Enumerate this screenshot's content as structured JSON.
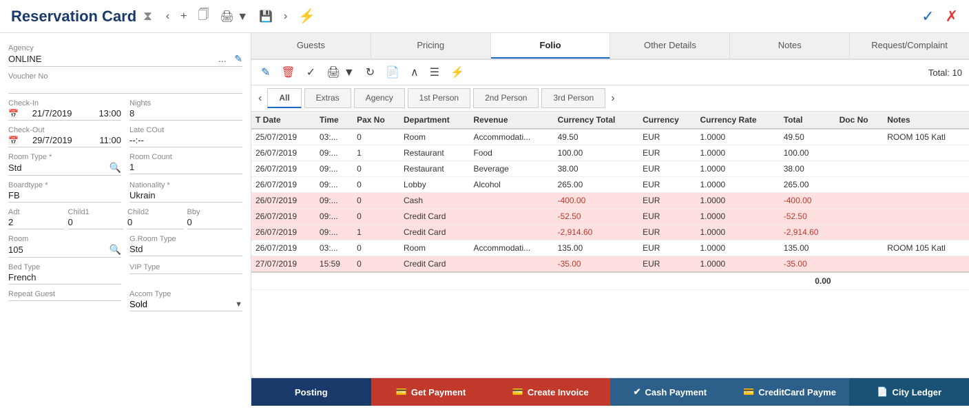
{
  "header": {
    "title": "Reservation Card",
    "check_label": "✓",
    "x_label": "✗"
  },
  "left": {
    "agency_label": "Agency",
    "agency_value": "ONLINE",
    "voucher_label": "Voucher No",
    "checkin_label": "Check-In",
    "checkin_date": "21/7/2019",
    "checkin_time": "13:00",
    "nights_label": "Nights",
    "nights_value": "8",
    "checkout_label": "Check-Out",
    "checkout_date": "29/7/2019",
    "checkout_time": "11:00",
    "late_cout_label": "Late COut",
    "late_cout_value": "--:--",
    "room_type_label": "Room Type *",
    "room_type_value": "Std",
    "room_count_label": "Room Count",
    "room_count_value": "1",
    "boardtype_label": "Boardtype *",
    "boardtype_value": "FB",
    "nationality_label": "Nationality *",
    "nationality_value": "Ukrain",
    "adt_label": "Adt",
    "adt_value": "2",
    "child1_label": "Child1",
    "child1_value": "0",
    "child2_label": "Child2",
    "child2_value": "0",
    "bby_label": "Bby",
    "bby_value": "0",
    "room_label": "Room",
    "room_value": "105",
    "groom_type_label": "G.Room Type",
    "groom_type_value": "Std",
    "bed_type_label": "Bed Type",
    "bed_type_value": "French",
    "vip_type_label": "VIP Type",
    "vip_type_value": "",
    "repeat_guest_label": "Repeat Guest",
    "accom_type_label": "Accom Type",
    "accom_type_value": "Sold"
  },
  "tabs": [
    "Guests",
    "Pricing",
    "Folio",
    "Other Details",
    "Notes",
    "Request/Complaint"
  ],
  "active_tab": "Folio",
  "sub_tabs": [
    "All",
    "Extras",
    "Agency",
    "1st Person",
    "2nd Person",
    "3rd Person"
  ],
  "active_sub_tab": "All",
  "total_label": "Total: 10",
  "columns": [
    "T Date",
    "Time",
    "Pax No",
    "Department",
    "Revenue",
    "Currency Total",
    "Currency",
    "Currency Rate",
    "Total",
    "Doc No",
    "Notes"
  ],
  "rows": [
    {
      "date": "25/07/2019",
      "time": "03:...",
      "pax": "0",
      "dept": "Room",
      "revenue": "Accommodati...",
      "cur_total": "49.50",
      "currency": "EUR",
      "cur_rate": "1.0000",
      "total": "49.50",
      "doc": "",
      "notes": "ROOM 105 Katl",
      "neg": false
    },
    {
      "date": "26/07/2019",
      "time": "09:...",
      "pax": "1",
      "dept": "Restaurant",
      "revenue": "Food",
      "cur_total": "100.00",
      "currency": "EUR",
      "cur_rate": "1.0000",
      "total": "100.00",
      "doc": "",
      "notes": "",
      "neg": false
    },
    {
      "date": "26/07/2019",
      "time": "09:...",
      "pax": "0",
      "dept": "Restaurant",
      "revenue": "Beverage",
      "cur_total": "38.00",
      "currency": "EUR",
      "cur_rate": "1.0000",
      "total": "38.00",
      "doc": "",
      "notes": "",
      "neg": false
    },
    {
      "date": "26/07/2019",
      "time": "09:...",
      "pax": "0",
      "dept": "Lobby",
      "revenue": "Alcohol",
      "cur_total": "265.00",
      "currency": "EUR",
      "cur_rate": "1.0000",
      "total": "265.00",
      "doc": "",
      "notes": "",
      "neg": false
    },
    {
      "date": "26/07/2019",
      "time": "09:...",
      "pax": "0",
      "dept": "Cash",
      "revenue": "",
      "cur_total": "-400.00",
      "currency": "EUR",
      "cur_rate": "1.0000",
      "total": "-400.00",
      "doc": "",
      "notes": "",
      "neg": true
    },
    {
      "date": "26/07/2019",
      "time": "09:...",
      "pax": "0",
      "dept": "Credit Card",
      "revenue": "",
      "cur_total": "-52.50",
      "currency": "EUR",
      "cur_rate": "1.0000",
      "total": "-52.50",
      "doc": "",
      "notes": "",
      "neg": true
    },
    {
      "date": "26/07/2019",
      "time": "09:...",
      "pax": "1",
      "dept": "Credit Card",
      "revenue": "",
      "cur_total": "-2,914.60",
      "currency": "EUR",
      "cur_rate": "1.0000",
      "total": "-2,914.60",
      "doc": "",
      "notes": "",
      "neg": true
    },
    {
      "date": "26/07/2019",
      "time": "03:...",
      "pax": "0",
      "dept": "Room",
      "revenue": "Accommodati...",
      "cur_total": "135.00",
      "currency": "EUR",
      "cur_rate": "1.0000",
      "total": "135.00",
      "doc": "",
      "notes": "ROOM 105 Katl",
      "neg": false
    },
    {
      "date": "27/07/2019",
      "time": "15:59",
      "pax": "0",
      "dept": "Credit Card",
      "revenue": "",
      "cur_total": "-35.00",
      "currency": "EUR",
      "cur_rate": "1.0000",
      "total": "-35.00",
      "doc": "",
      "notes": "",
      "neg": true
    }
  ],
  "grand_total": "0.00",
  "buttons": {
    "posting": "Posting",
    "get_payment": "Get Payment",
    "create_invoice": "Create Invoice",
    "cash_payment": "Cash Payment",
    "credit_card": "CreditCard Payme",
    "city_ledger": "City Ledger"
  }
}
